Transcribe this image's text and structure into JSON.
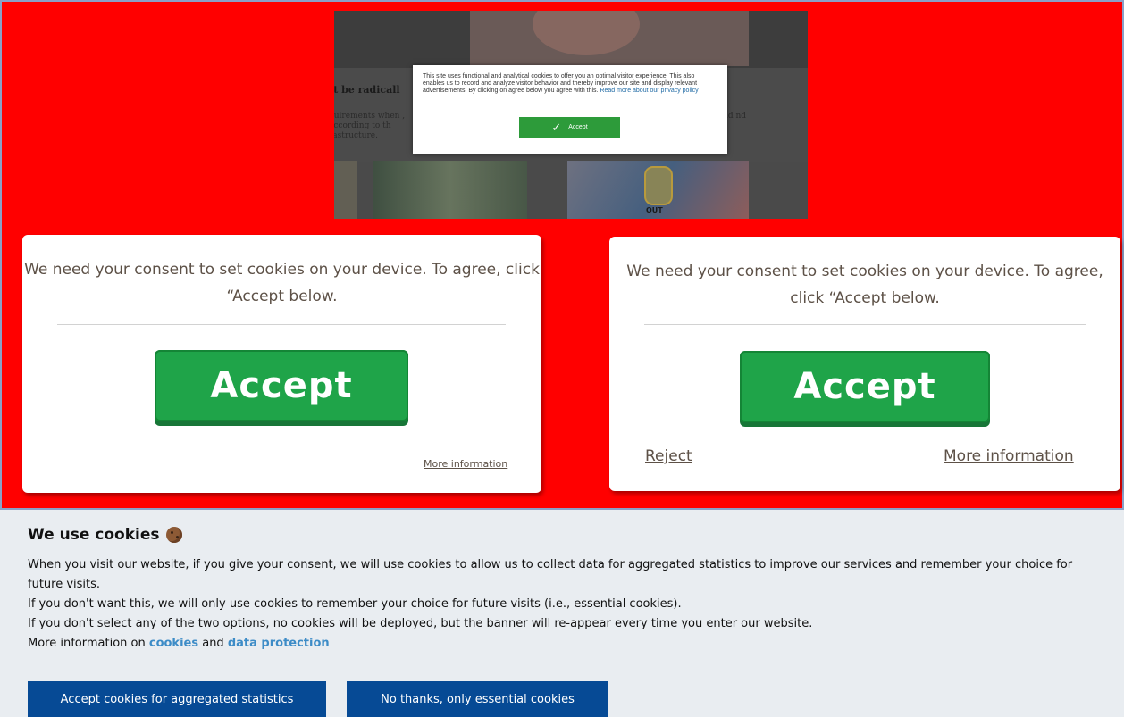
{
  "embedded_preview": {
    "headline": "st be radicall",
    "body": "quirements when , according to th rastructure.",
    "right_text": "ld nd",
    "modal_text": "This site uses functional and analytical cookies to offer you an optimal visitor experience. This also enables us to record and analyze visitor behavior and thereby improve our site and display relevant advertisements. By clicking on agree below you agree with this.",
    "privacy_link": "Read more about our privacy policy",
    "accept_label": "Accept",
    "sign_text": "OUT"
  },
  "left_card": {
    "message": "We need your consent to set cookies on your device. To agree, click “Accept below.",
    "accept_label": "Accept",
    "more_label": "More information"
  },
  "right_card": {
    "message": "We need your consent to set cookies on your device. To agree, click “Accept below.",
    "accept_label": "Accept",
    "reject_label": "Reject",
    "more_label": "More information"
  },
  "cookie_banner": {
    "title": "We use cookies",
    "line1": "When you visit our website, if you give your consent, we will use cookies to allow us to collect data for aggregated statistics to improve our services and remember your choice for future visits.",
    "line2": "If you don't want this, we will only use cookies to remember your choice for future visits (i.e., essential cookies).",
    "line3": "If you don't select any of the two options, no cookies will be deployed, but the banner will re-appear every time you enter our website.",
    "line4_prefix": "More information on ",
    "cookies_link": "cookies",
    "line4_middle": " and ",
    "data_protection_link": "data protection",
    "accept_button": "Accept cookies for aggregated statistics",
    "essential_button": "No thanks, only essential cookies"
  }
}
